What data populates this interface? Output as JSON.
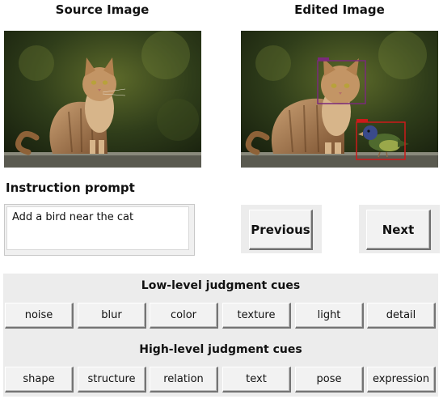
{
  "source_panel": {
    "title": "Source Image",
    "image_icon": "cat-photo"
  },
  "edited_panel": {
    "title": "Edited Image",
    "image_icon": "cat-with-bird-photo",
    "box_colors": {
      "cat": "#7a2a7a",
      "bird": "#cc1a1a"
    }
  },
  "instruction": {
    "title": "Instruction prompt",
    "value": "Add a bird near the cat"
  },
  "nav": {
    "previous_label": "Previous",
    "next_label": "Next"
  },
  "low_cues": {
    "title": "Low-level judgment cues",
    "buttons": [
      "noise",
      "blur",
      "color",
      "texture",
      "light",
      "detail"
    ]
  },
  "high_cues": {
    "title": "High-level judgment cues",
    "buttons": [
      "shape",
      "structure",
      "relation",
      "text",
      "pose",
      "expression"
    ]
  }
}
